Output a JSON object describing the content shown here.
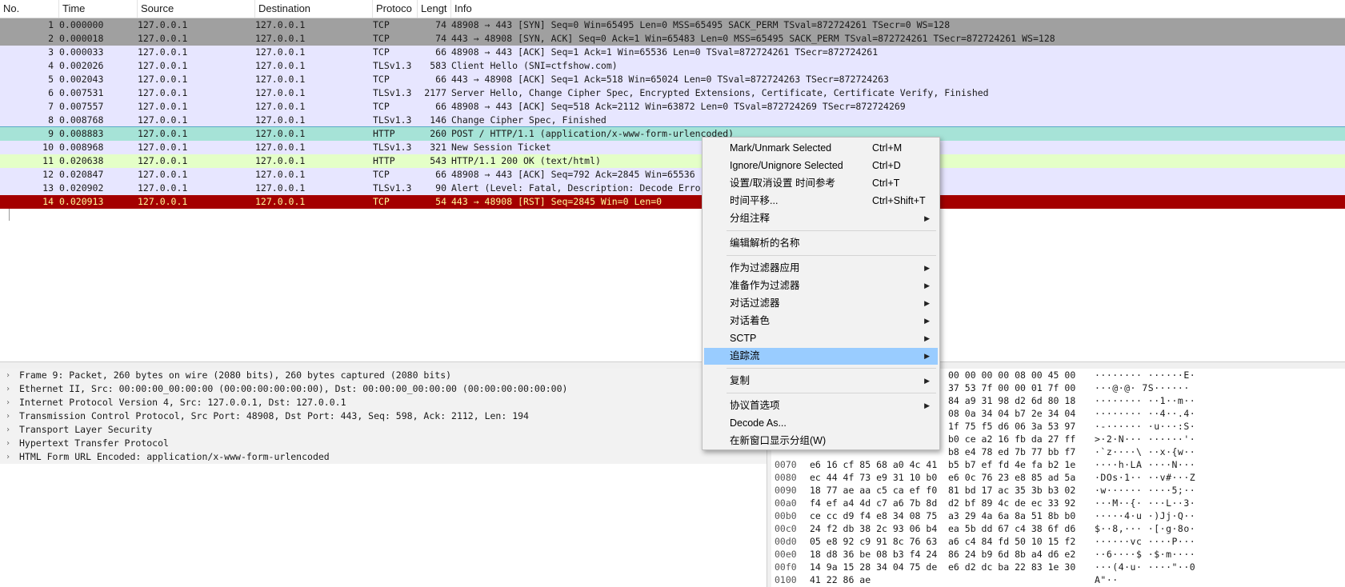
{
  "columns": {
    "no": "No.",
    "time": "Time",
    "source": "Source",
    "destination": "Destination",
    "protocol": "Protoco",
    "length": "Lengt",
    "info": "Info"
  },
  "packets": [
    {
      "no": "1",
      "time": "0.000000",
      "src": "127.0.0.1",
      "dst": "127.0.0.1",
      "proto": "TCP",
      "len": "74",
      "info": "48908 → 443 [SYN] Seq=0 Win=65495 Len=0 MSS=65495 SACK_PERM TSval=872724261 TSecr=0 WS=128"
    },
    {
      "no": "2",
      "time": "0.000018",
      "src": "127.0.0.1",
      "dst": "127.0.0.1",
      "proto": "TCP",
      "len": "74",
      "info": "443 → 48908 [SYN, ACK] Seq=0 Ack=1 Win=65483 Len=0 MSS=65495 SACK_PERM TSval=872724261 TSecr=872724261 WS=128"
    },
    {
      "no": "3",
      "time": "0.000033",
      "src": "127.0.0.1",
      "dst": "127.0.0.1",
      "proto": "TCP",
      "len": "66",
      "info": "48908 → 443 [ACK] Seq=1 Ack=1 Win=65536 Len=0 TSval=872724261 TSecr=872724261"
    },
    {
      "no": "4",
      "time": "0.002026",
      "src": "127.0.0.1",
      "dst": "127.0.0.1",
      "proto": "TLSv1.3",
      "len": "583",
      "info": "Client Hello (SNI=ctfshow.com)"
    },
    {
      "no": "5",
      "time": "0.002043",
      "src": "127.0.0.1",
      "dst": "127.0.0.1",
      "proto": "TCP",
      "len": "66",
      "info": "443 → 48908 [ACK] Seq=1 Ack=518 Win=65024 Len=0 TSval=872724263 TSecr=872724263"
    },
    {
      "no": "6",
      "time": "0.007531",
      "src": "127.0.0.1",
      "dst": "127.0.0.1",
      "proto": "TLSv1.3",
      "len": "2177",
      "info": "Server Hello, Change Cipher Spec, Encrypted Extensions, Certificate, Certificate Verify, Finished"
    },
    {
      "no": "7",
      "time": "0.007557",
      "src": "127.0.0.1",
      "dst": "127.0.0.1",
      "proto": "TCP",
      "len": "66",
      "info": "48908 → 443 [ACK] Seq=518 Ack=2112 Win=63872 Len=0 TSval=872724269 TSecr=872724269"
    },
    {
      "no": "8",
      "time": "0.008768",
      "src": "127.0.0.1",
      "dst": "127.0.0.1",
      "proto": "TLSv1.3",
      "len": "146",
      "info": "Change Cipher Spec, Finished"
    },
    {
      "no": "9",
      "time": "0.008883",
      "src": "127.0.0.1",
      "dst": "127.0.0.1",
      "proto": "HTTP",
      "len": "260",
      "info": "POST / HTTP/1.1  (application/x-www-form-urlencoded)"
    },
    {
      "no": "10",
      "time": "0.008968",
      "src": "127.0.0.1",
      "dst": "127.0.0.1",
      "proto": "TLSv1.3",
      "len": "321",
      "info": "New Session Ticket"
    },
    {
      "no": "11",
      "time": "0.020638",
      "src": "127.0.0.1",
      "dst": "127.0.0.1",
      "proto": "HTTP",
      "len": "543",
      "info": "HTTP/1.1 200 OK  (text/html)"
    },
    {
      "no": "12",
      "time": "0.020847",
      "src": "127.0.0.1",
      "dst": "127.0.0.1",
      "proto": "TCP",
      "len": "66",
      "info": "48908 → 443 [ACK] Seq=792 Ack=2845 Win=65536"
    },
    {
      "no": "13",
      "time": "0.020902",
      "src": "127.0.0.1",
      "dst": "127.0.0.1",
      "proto": "TLSv1.3",
      "len": "90",
      "info": "Alert (Level: Fatal, Description: Decode Erro"
    },
    {
      "no": "14",
      "time": "0.020913",
      "src": "127.0.0.1",
      "dst": "127.0.0.1",
      "proto": "TCP",
      "len": "54",
      "info": "443 → 48908 [RST] Seq=2845 Win=0 Len=0"
    }
  ],
  "details": [
    "Frame 9: Packet, 260 bytes on wire (2080 bits), 260 bytes captured (2080 bits)",
    "Ethernet II, Src: 00:00:00_00:00:00 (00:00:00:00:00:00), Dst: 00:00:00_00:00:00 (00:00:00:00:00:00)",
    "Internet Protocol Version 4, Src: 127.0.0.1, Dst: 127.0.0.1",
    "Transmission Control Protocol, Src Port: 48908, Dst Port: 443, Seq: 598, Ack: 2112, Len: 194",
    "Transport Layer Security",
    "Hypertext Transfer Protocol",
    "HTML Form URL Encoded: application/x-www-form-urlencoded"
  ],
  "hex": [
    {
      "off": "",
      "b1": "",
      "b2": "00 00 00 00 08 00 45 00",
      "asc": "········ ······E·"
    },
    {
      "off": "",
      "b1": "",
      "b2": "37 53 7f 00 00 01 7f 00",
      "asc": "···@·@· 7S······"
    },
    {
      "off": "",
      "b1": "",
      "b2": "84 a9 31 98 d2 6d 80 18",
      "asc": "········ ··1··m··"
    },
    {
      "off": "",
      "b1": "",
      "b2": "08 0a 34 04 b7 2e 34 04",
      "asc": "········ ··4··.4·"
    },
    {
      "off": "",
      "b1": "",
      "b2": "1f 75 f5 d6 06 3a 53 97",
      "asc": "·-······ ·u···:S·"
    },
    {
      "off": "",
      "b1": "",
      "b2": "b0 ce a2 16 fb da 27 ff",
      "asc": ">·2·N··· ······'·"
    },
    {
      "off": "",
      "b1": "",
      "b2": "b8 e4 78 ed 7b 77 bb f7",
      "asc": "·`z····\\ ··x·{w··"
    },
    {
      "off": "0070",
      "b1": "e6 16 cf 85 68 a0 4c 41",
      "b2": "b5 b7 ef fd 4e fa b2 1e",
      "asc": "····h·LA ····N···"
    },
    {
      "off": "0080",
      "b1": "ec 44 4f 73 e9 31 10 b0",
      "b2": "e6 0c 76 23 e8 85 ad 5a",
      "asc": "·DOs·1·· ··v#···Z"
    },
    {
      "off": "0090",
      "b1": "18 77 ae aa c5 ca ef f0",
      "b2": "81 bd 17 ac 35 3b b3 02",
      "asc": "·w······ ····5;··"
    },
    {
      "off": "00a0",
      "b1": "f4 ef a4 4d c7 a6 7b 8d",
      "b2": "d2 bf 89 4c de ec 33 92",
      "asc": "···M··{· ···L··3·"
    },
    {
      "off": "00b0",
      "b1": "ce cc d9 f4 e8 34 08 75",
      "b2": "a3 29 4a 6a 8a 51 8b b0",
      "asc": "·····4·u ·)Jj·Q··"
    },
    {
      "off": "00c0",
      "b1": "24 f2 db 38 2c 93 06 b4",
      "b2": "ea 5b dd 67 c4 38 6f d6",
      "asc": "$··8,··· ·[·g·8o·"
    },
    {
      "off": "00d0",
      "b1": "05 e8 92 c9 91 8c 76 63",
      "b2": "a6 c4 84 fd 50 10 15 f2",
      "asc": "······vc ····P···"
    },
    {
      "off": "00e0",
      "b1": "18 d8 36 be 08 b3 f4 24",
      "b2": "86 24 b9 6d 8b a4 d6 e2",
      "asc": "··6····$ ·$·m····"
    },
    {
      "off": "00f0",
      "b1": "14 9a 15 28 34 04 75 de",
      "b2": "e6 d2 dc ba 22 83 1e 30",
      "asc": "···(4·u· ····\"··0"
    },
    {
      "off": "0100",
      "b1": "41 22 86 ae",
      "b2": "",
      "asc": "A\"··"
    }
  ],
  "context_menu": [
    {
      "label": "Mark/Unmark Selected",
      "shortcut": "Ctrl+M",
      "sub": false
    },
    {
      "label": "Ignore/Unignore Selected",
      "shortcut": "Ctrl+D",
      "sub": false
    },
    {
      "label": "设置/取消设置 时间参考",
      "shortcut": "Ctrl+T",
      "sub": false
    },
    {
      "label": "时间平移...",
      "shortcut": "Ctrl+Shift+T",
      "sub": false
    },
    {
      "label": "分组注释",
      "shortcut": "",
      "sub": true
    },
    {
      "label": "编辑解析的名称",
      "shortcut": "",
      "sub": false
    },
    {
      "label": "作为过滤器应用",
      "shortcut": "",
      "sub": true
    },
    {
      "label": "准备作为过滤器",
      "shortcut": "",
      "sub": true
    },
    {
      "label": "对话过滤器",
      "shortcut": "",
      "sub": true
    },
    {
      "label": "对话着色",
      "shortcut": "",
      "sub": true
    },
    {
      "label": "SCTP",
      "shortcut": "",
      "sub": true
    },
    {
      "label": "追踪流",
      "shortcut": "",
      "sub": true
    },
    {
      "label": "复制",
      "shortcut": "",
      "sub": true
    },
    {
      "label": "协议首选项",
      "shortcut": "",
      "sub": true
    },
    {
      "label": "Decode As...",
      "shortcut": "",
      "sub": false
    },
    {
      "label": "在新窗口显示分组(W)",
      "shortcut": "",
      "sub": false
    }
  ],
  "icons": {
    "submenu_arrow": "▶",
    "tree_expand": "›"
  },
  "colors": {
    "tcp_handshake": "#a0a0a0",
    "default_row": "#e7e6ff",
    "selected": "#a6e3d7",
    "http_response": "#e4ffc7",
    "rst": "#a40000",
    "rst_text": "#fffc9c",
    "menu_highlight": "#99ccff"
  }
}
